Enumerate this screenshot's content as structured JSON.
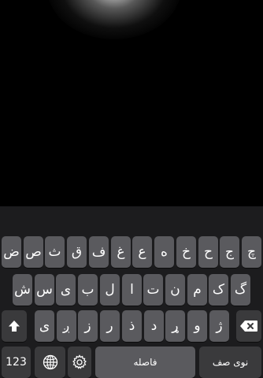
{
  "keyboard": {
    "row1": [
      "چ",
      "ج",
      "ح",
      "خ",
      "ه",
      "ع",
      "غ",
      "ف",
      "ق",
      "ث",
      "ص",
      "ض"
    ],
    "row2": [
      "گ",
      "ک",
      "م",
      "ن",
      "ت",
      "ا",
      "ل",
      "ب",
      "ی",
      "س",
      "ش"
    ],
    "row3": [
      "ژ",
      "و",
      "ړ",
      "د",
      "ذ",
      "ر",
      "ز",
      "ږ",
      "ی"
    ],
    "bottom": {
      "numbers_label": "123",
      "space_label": "فاصله",
      "return_label": "نوی صف"
    },
    "icons": {
      "shift": "shift-icon",
      "backspace": "backspace-icon",
      "globe": "globe-icon",
      "settings": "gear-icon"
    }
  }
}
